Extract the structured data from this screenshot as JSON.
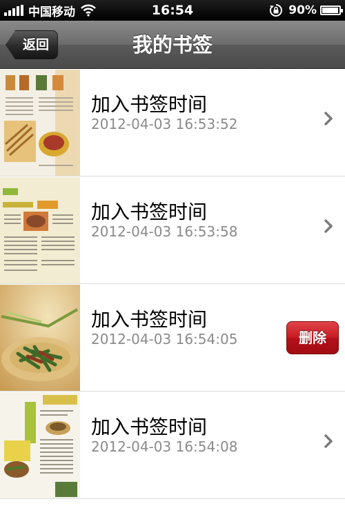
{
  "status_bar": {
    "carrier": "中国移动",
    "time": "16:54",
    "battery_percent": "90%",
    "battery_level": 0.9,
    "icons": [
      "signal-icon",
      "wifi-icon",
      "rotation-lock-icon",
      "battery-icon"
    ]
  },
  "nav": {
    "title": "我的书签",
    "back_label": "返回"
  },
  "bookmarks": [
    {
      "title": "加入书签时间",
      "time": "2012-04-03 16:53:52",
      "action": "chevron"
    },
    {
      "title": "加入书签时间",
      "time": "2012-04-03 16:53:58",
      "action": "chevron"
    },
    {
      "title": "加入书签时间",
      "time": "2012-04-03 16:54:05",
      "action": "delete",
      "delete_label": "删除"
    },
    {
      "title": "加入书签时间",
      "time": "2012-04-03 16:54:08",
      "action": "chevron"
    }
  ],
  "colors": {
    "delete_red": "#c81a22",
    "timestamp_gray": "#8a8a8a",
    "nav_gray": "#6c6c6c"
  }
}
